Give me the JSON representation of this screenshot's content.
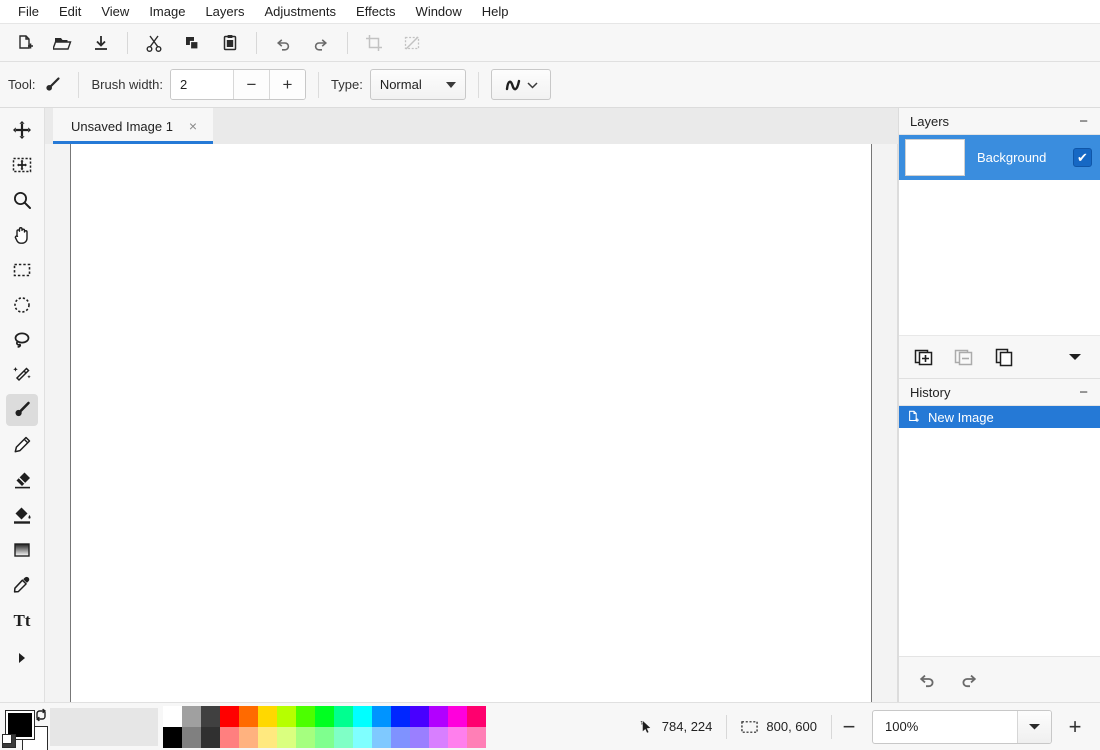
{
  "menubar": {
    "items": [
      {
        "label": "File"
      },
      {
        "label": "Edit"
      },
      {
        "label": "View"
      },
      {
        "label": "Image"
      },
      {
        "label": "Layers"
      },
      {
        "label": "Adjustments"
      },
      {
        "label": "Effects"
      },
      {
        "label": "Window"
      },
      {
        "label": "Help"
      }
    ]
  },
  "toolbar": {
    "buttons": [
      {
        "name": "new-image-icon",
        "title": "New"
      },
      {
        "name": "open-file-icon",
        "title": "Open"
      },
      {
        "name": "save-file-icon",
        "title": "Save"
      },
      {
        "name": "cut-icon",
        "title": "Cut"
      },
      {
        "name": "copy-icon",
        "title": "Copy"
      },
      {
        "name": "paste-icon",
        "title": "Paste"
      },
      {
        "name": "undo-icon",
        "title": "Undo"
      },
      {
        "name": "redo-icon",
        "title": "Redo"
      },
      {
        "name": "crop-icon",
        "title": "Crop to Selection"
      },
      {
        "name": "deselect-icon",
        "title": "Deselect"
      }
    ]
  },
  "options_bar": {
    "tool_label": "Tool:",
    "tool_icon": "paintbrush-icon",
    "brush_width_label": "Brush width:",
    "brush_width_value": "2",
    "decrement_label": "−",
    "increment_label": "+",
    "type_label": "Type:",
    "type_value": "Normal",
    "brush_style_icon": "squiggle-icon"
  },
  "tools": [
    {
      "name": "move-selected-pixels",
      "icon": "move-arrows-icon",
      "active": false
    },
    {
      "name": "move-selection",
      "icon": "move-selection-icon",
      "active": false
    },
    {
      "name": "zoom",
      "icon": "magnifier-icon",
      "active": false
    },
    {
      "name": "pan",
      "icon": "hand-icon",
      "active": false
    },
    {
      "name": "rectangle-select",
      "icon": "rectangle-select-icon",
      "active": false
    },
    {
      "name": "ellipse-select",
      "icon": "ellipse-select-icon",
      "active": false
    },
    {
      "name": "lasso-select",
      "icon": "lasso-icon",
      "active": false
    },
    {
      "name": "magic-wand",
      "icon": "magic-wand-icon",
      "active": false
    },
    {
      "name": "paintbrush",
      "icon": "paintbrush-icon",
      "active": true
    },
    {
      "name": "pencil",
      "icon": "pencil-icon",
      "active": false
    },
    {
      "name": "eraser",
      "icon": "eraser-icon",
      "active": false
    },
    {
      "name": "paint-bucket",
      "icon": "paint-bucket-icon",
      "active": false
    },
    {
      "name": "gradient",
      "icon": "gradient-icon",
      "active": false
    },
    {
      "name": "color-picker",
      "icon": "eyedropper-icon",
      "active": false
    },
    {
      "name": "text",
      "icon": "text-icon",
      "active": false
    }
  ],
  "tools_expand_icon": "expand-arrow-icon",
  "tabs": [
    {
      "label": "Unsaved Image 1",
      "close_label": "×",
      "active": true
    }
  ],
  "layers_panel": {
    "title": "Layers",
    "minimize_label": "−",
    "rows": [
      {
        "name": "Background",
        "selected": true,
        "visible": true,
        "check_label": "✔"
      }
    ],
    "actions": [
      {
        "name": "add-layer-icon",
        "disabled": false
      },
      {
        "name": "delete-layer-icon",
        "disabled": true
      },
      {
        "name": "duplicate-layer-icon",
        "disabled": false
      },
      {
        "name": "layer-menu-chevron-icon",
        "disabled": false
      }
    ]
  },
  "history_panel": {
    "title": "History",
    "minimize_label": "−",
    "rows": [
      {
        "label": "New Image",
        "icon": "new-image-icon",
        "selected": true
      }
    ],
    "actions": [
      {
        "name": "history-undo-icon"
      },
      {
        "name": "history-redo-icon"
      }
    ]
  },
  "status_bar": {
    "cursor_icon": "cursor-icon",
    "cursor_position": "784, 224",
    "selection_icon": "selection-size-icon",
    "image_size": "800, 600",
    "zoom_out_label": "−",
    "zoom_value": "100%",
    "zoom_in_label": "+"
  },
  "colors": {
    "primary": "#000000",
    "secondary": "#ffffff",
    "swap_icon": "swap-colors-icon",
    "reset_icon": "reset-colors-icon",
    "palette_row1": [
      "#ffffff",
      "#a0a0a0",
      "#404040",
      "#ff0000",
      "#ff6a00",
      "#ffd800",
      "#b6ff00",
      "#4cff00",
      "#00ff21",
      "#00ff90",
      "#00ffff",
      "#0094ff",
      "#0026ff",
      "#4800ff",
      "#b200ff",
      "#ff00dc",
      "#ff006e"
    ],
    "palette_row2": [
      "#000000",
      "#808080",
      "#303030",
      "#ff7f7f",
      "#ffb27f",
      "#ffe97f",
      "#daff7f",
      "#a5ff7f",
      "#7fff8e",
      "#7fffc6",
      "#7fffff",
      "#7fc9ff",
      "#7f92ff",
      "#9a7fff",
      "#d87fff",
      "#ff7fed",
      "#ff7fb6"
    ]
  },
  "accent_color": "#2579d6"
}
